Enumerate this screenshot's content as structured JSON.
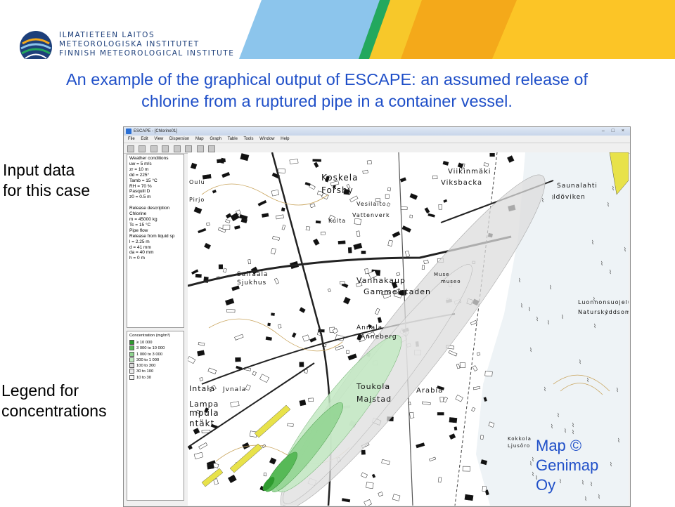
{
  "header": {
    "logo_lines": [
      "ILMATIETEEN LAITOS",
      "METEOROLOGISKA INSTITUTET",
      "FINNISH METEOROLOGICAL INSTITUTE"
    ],
    "title_lines": [
      "An example of the graphical output of ESCAPE: an assumed  release of",
      "chlorine from a ruptured pipe in a container vessel."
    ]
  },
  "labels": {
    "input_data": [
      "Input data",
      "for this case"
    ],
    "legend": [
      "Legend for",
      "concentrations"
    ],
    "copyright": [
      "Map ©",
      "Genimap",
      "Oy"
    ]
  },
  "app": {
    "window_title": "ESCAPE - [Chlorine01]",
    "window_controls": "– □ ×",
    "menu": [
      "File",
      "Edit",
      "View",
      "Dispersion",
      "Map",
      "Graph",
      "Table",
      "Tools",
      "Window",
      "Help"
    ],
    "weather_panel": [
      "Weather conditions",
      "uw = 5 m/s",
      "zr = 10 m",
      "dd = 225°",
      "Tamb = 15 °C",
      "RH = 70 %",
      "Pasquill D",
      "z0 = 0.5 m",
      "",
      "Release description",
      "Chlorine",
      "m = 45000 kg",
      "Tc = 15 °C",
      "Pipe flow",
      "Release from liquid sp",
      "l = 2.25 m",
      "d = 41 mm",
      "da = 40 mm",
      "h = 0 m"
    ],
    "legend_panel": {
      "title": "Concentration (mg/m³)",
      "items": [
        {
          "range": "≥ 10 000",
          "color": "#2e9a2e"
        },
        {
          "range": "3 000 to 10 000",
          "color": "#57b957"
        },
        {
          "range": "1 000 to 3 000",
          "color": "#8fd48f"
        },
        {
          "range": "300 to 1 000",
          "color": "#c3e9c3"
        },
        {
          "range": "100 to 300",
          "color": "#dcdcdc"
        },
        {
          "range": "30 to 100",
          "color": "#ececec"
        },
        {
          "range": "10 to 30",
          "color": "#f7f7f7"
        }
      ]
    },
    "map_places": [
      "Koskela",
      "Forsby",
      "Vesilaito",
      "Vattenverk",
      "Viikinmäki",
      "Viksbacka",
      "Saunalahti",
      "Idöviken",
      "Sairaala",
      "Sjukhus",
      "Vanhakaup",
      "Gammelstaden",
      "Annala",
      "Anneberg",
      "Arabia",
      "Toukola",
      "Majstad",
      "Luonnonsuojelua",
      "Naturskyddsomr",
      "Kokkola",
      "Ljusöro",
      "Oulu",
      "Pirjo",
      "Intala",
      "Lampa",
      "Kulta",
      "mpula",
      "ntäkt",
      "Jvnala",
      "Muse",
      "museo"
    ]
  }
}
